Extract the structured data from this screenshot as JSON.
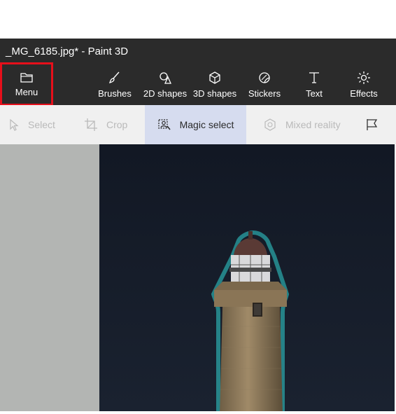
{
  "window": {
    "title": "_MG_6185.jpg* - Paint 3D"
  },
  "toolbar": {
    "menu_label": "Menu",
    "brushes_label": "Brushes",
    "shapes2d_label": "2D shapes",
    "shapes3d_label": "3D shapes",
    "stickers_label": "Stickers",
    "text_label": "Text",
    "effects_label": "Effects"
  },
  "subtoolbar": {
    "select_label": "Select",
    "crop_label": "Crop",
    "magic_select_label": "Magic select",
    "mixed_reality_label": "Mixed reality"
  },
  "colors": {
    "highlight_border": "#e60f1b",
    "toolbar_bg": "#2b2b2b",
    "active_tool_bg": "#d6dcef",
    "selection_outline": "#2ec4c4"
  },
  "icons": {
    "menu": "folder-icon",
    "brushes": "brush-icon",
    "shapes2d": "2d-shapes-icon",
    "shapes3d": "cube-icon",
    "stickers": "sticker-icon",
    "text": "text-icon",
    "effects": "sun-icon",
    "select": "cursor-icon",
    "crop": "crop-icon",
    "magic_select": "magic-select-icon",
    "mixed_reality": "mixed-reality-icon",
    "flag": "flag-icon"
  }
}
